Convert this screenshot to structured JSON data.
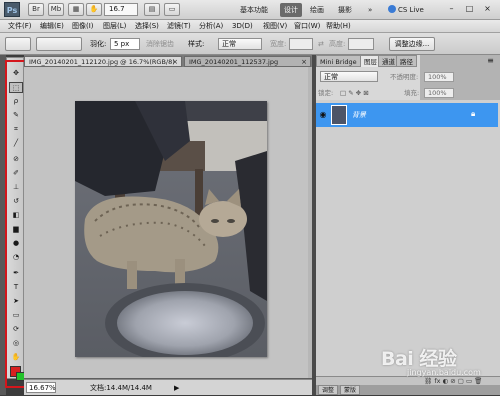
{
  "app": {
    "logo": "Ps",
    "zoom": "16.7",
    "workspaces": [
      "基本功能",
      "设计",
      "绘画",
      "摄影"
    ],
    "more": "»",
    "cs_live": "CS Live",
    "window_buttons": [
      "–",
      "□",
      "×"
    ]
  },
  "menu": [
    "文件(F)",
    "编辑(E)",
    "图像(I)",
    "图层(L)",
    "选择(S)",
    "滤镜(T)",
    "分析(A)",
    "3D(D)",
    "视图(V)",
    "窗口(W)",
    "帮助(H)"
  ],
  "options": {
    "feather_label": "羽化:",
    "feather_value": "5 px",
    "antialias_label": "消除锯齿",
    "style_label": "样式:",
    "style_value": "正常",
    "width_label": "宽度:",
    "height_label": "高度:",
    "refine_edge": "调整边缘..."
  },
  "tabs": [
    {
      "label": "IMG_20140201_112120.jpg @ 16.7%(RGB/8)",
      "close": "×"
    },
    {
      "label": "IMG_20140201_112537.jpg",
      "close": "×"
    }
  ],
  "status": {
    "zoom": "16.67%",
    "doc": "文档:14.4M/14.4M"
  },
  "panels": {
    "tabs": [
      "Mini Bridge",
      "图层",
      "通道",
      "路径"
    ],
    "blend_mode": "正常",
    "opacity_label": "不透明度:",
    "opacity_value": "100%",
    "lock_label": "锁定:",
    "fill_label": "填充:",
    "fill_value": "100%",
    "layer_name": "背景",
    "bottom_tabs": [
      "调整",
      "蒙版"
    ]
  },
  "watermark": {
    "main": "Bai 经验",
    "sub": "jingyan.baidu.com"
  },
  "colors": {
    "foreground": "#d62020",
    "background": "#22c22a",
    "layer_selected": "#3d96f0",
    "highlight_frame": "#d4161c"
  }
}
